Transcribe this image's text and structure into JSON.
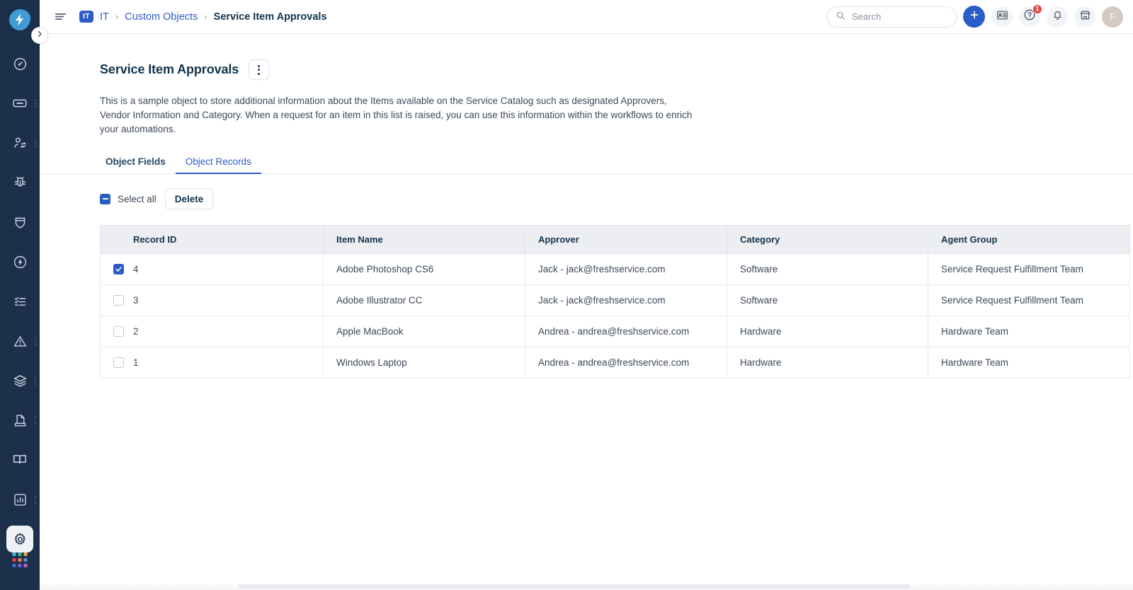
{
  "brand": {
    "logo_icon": "freshservice-bolt-logo",
    "accent_color": "#2c5cc5",
    "rail_bg": "#1c3049"
  },
  "rail": {
    "collapse_icon": "chevron-right-icon",
    "items": [
      {
        "icon": "dashboard-gauge-icon",
        "name": "dashboard",
        "has_menu": false
      },
      {
        "icon": "ticket-icon",
        "name": "tickets",
        "has_menu": true
      },
      {
        "icon": "user-swap-icon",
        "name": "changes-requesters",
        "has_menu": true
      },
      {
        "icon": "bug-icon",
        "name": "problems",
        "has_menu": false
      },
      {
        "icon": "shield-icon",
        "name": "releases",
        "has_menu": false
      },
      {
        "icon": "bolt-circle-icon",
        "name": "changes",
        "has_menu": false
      },
      {
        "icon": "checklist-icon",
        "name": "tasks",
        "has_menu": false
      },
      {
        "icon": "alert-triangle-icon",
        "name": "alerts",
        "has_menu": true
      },
      {
        "icon": "layers-icon",
        "name": "assets",
        "has_menu": true
      },
      {
        "icon": "contract-icon",
        "name": "contracts",
        "has_menu": true
      },
      {
        "icon": "book-icon",
        "name": "solutions",
        "has_menu": false
      },
      {
        "icon": "bar-chart-icon",
        "name": "analytics",
        "has_menu": true
      },
      {
        "icon": "gear-icon",
        "name": "admin",
        "has_menu": false,
        "selected": true
      }
    ],
    "apps_icon": "app-grid-icon",
    "apps_colors": [
      "#4cb3d4",
      "#3fb68b",
      "#e8a33d",
      "#e8483f",
      "#f0834e",
      "#5a8fd6",
      "#3d6fd1",
      "#6b5bd6",
      "#c05bd6"
    ]
  },
  "topbar": {
    "menu_icon": "hamburger-icon",
    "breadcrumb": {
      "workspace_badge": "IT",
      "workspace_label": "IT",
      "separator": "›",
      "parent_label": "Custom Objects",
      "current_label": "Service Item Approvals"
    },
    "search": {
      "icon": "search-icon",
      "placeholder": "Search",
      "value": ""
    },
    "actions": [
      {
        "name": "new-button",
        "icon": "plus-icon",
        "label": ""
      },
      {
        "name": "contacts-button",
        "icon": "contact-card-icon",
        "label": ""
      },
      {
        "name": "help-button",
        "icon": "question-circle-icon",
        "label": "",
        "badge": "1"
      },
      {
        "name": "notifications-button",
        "icon": "bell-icon",
        "label": ""
      },
      {
        "name": "marketplace-button",
        "icon": "marketplace-shop-icon",
        "label": ""
      }
    ],
    "avatar_initial": "F"
  },
  "page": {
    "title": "Service Item Approvals",
    "kebab_icon": "more-vertical-icon",
    "description": "This is a sample object to store additional information about the Items available on the Service Catalog such as designated Approvers, Vendor Information and Category. When a request for an item in this list is raised, you can use this information within the workflows to enrich your automations.",
    "tabs": [
      {
        "label": "Object Fields",
        "active": false
      },
      {
        "label": "Object Records",
        "active": true
      }
    ],
    "toolbar": {
      "select_all_label": "Select all",
      "select_all_state": "indeterminate",
      "delete_label": "Delete"
    }
  },
  "table": {
    "columns": [
      "Record ID",
      "Item Name",
      "Approver",
      "Category",
      "Agent Group"
    ],
    "rows": [
      {
        "selected": true,
        "record_id": "4",
        "item_name": "Adobe Photoshop CS6",
        "approver": "Jack - jack@freshservice.com",
        "category": "Software",
        "agent_group": "Service Request Fulfillment Team"
      },
      {
        "selected": false,
        "record_id": "3",
        "item_name": "Adobe Illustrator CC",
        "approver": "Jack - jack@freshservice.com",
        "category": "Software",
        "agent_group": "Service Request Fulfillment Team"
      },
      {
        "selected": false,
        "record_id": "2",
        "item_name": "Apple MacBook",
        "approver": "Andrea - andrea@freshservice.com",
        "category": "Hardware",
        "agent_group": "Hardware Team"
      },
      {
        "selected": false,
        "record_id": "1",
        "item_name": "Windows Laptop",
        "approver": "Andrea - andrea@freshservice.com",
        "category": "Hardware",
        "agent_group": "Hardware Team"
      }
    ]
  }
}
